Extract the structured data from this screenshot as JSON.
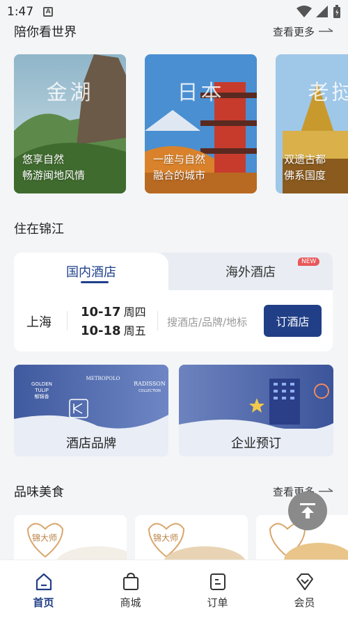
{
  "status_bar": {
    "time": "1:47"
  },
  "explore": {
    "title": "陪你看世界",
    "more": "查看更多",
    "cards": [
      {
        "big": "金湖",
        "line1": "悠享自然",
        "line2": "畅游闽地风情"
      },
      {
        "big": "日本",
        "line1": "一座与自然",
        "line2": "融合的城市"
      },
      {
        "big": "老挝",
        "line1": "双遗古都",
        "line2": "佛系国度"
      }
    ]
  },
  "stay": {
    "title": "住在锦江",
    "tab_domestic": "国内酒店",
    "tab_overseas": "海外酒店",
    "new_badge": "NEW",
    "city": "上海",
    "checkin_date": "10-17",
    "checkin_weekday": "周四",
    "checkout_date": "10-18",
    "checkout_weekday": "周五",
    "search_placeholder": "搜酒店/品牌/地标",
    "book_button": "订酒店"
  },
  "tiles": {
    "brand": {
      "label": "酒店品牌",
      "logo1": "GOLDEN TULIP",
      "logo1_cn": "郁锦香",
      "logo2": "METROPOLO",
      "logo3": "RADISSON",
      "logo3_sub": "COLLECTION"
    },
    "corporate": {
      "label": "企业预订"
    }
  },
  "food": {
    "title": "品味美食",
    "more": "查看更多",
    "tag": "锦大师"
  },
  "nav": {
    "home": "首页",
    "mall": "商城",
    "orders": "订单",
    "member": "会员"
  },
  "colors": {
    "primary": "#213f86",
    "badge": "#e8585a"
  }
}
